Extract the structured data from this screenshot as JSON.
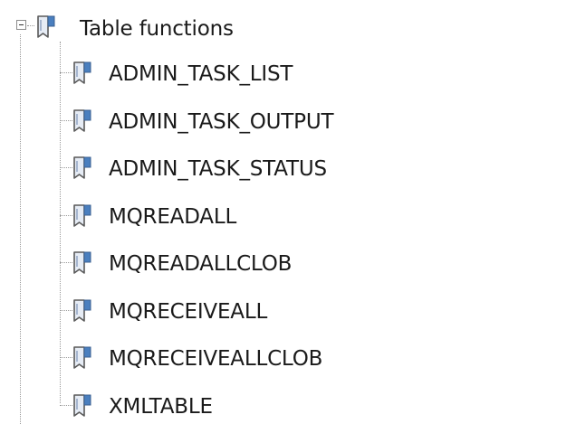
{
  "tree": {
    "root": {
      "label": "Table functions",
      "icon": "function-folder-icon",
      "expanded": true
    },
    "items": [
      {
        "label": "ADMIN_TASK_LIST",
        "icon": "function-icon"
      },
      {
        "label": "ADMIN_TASK_OUTPUT",
        "icon": "function-icon"
      },
      {
        "label": "ADMIN_TASK_STATUS",
        "icon": "function-icon"
      },
      {
        "label": "MQREADALL",
        "icon": "function-icon"
      },
      {
        "label": "MQREADALLCLOB",
        "icon": "function-icon"
      },
      {
        "label": "MQRECEIVEALL",
        "icon": "function-icon"
      },
      {
        "label": "MQRECEIVEALLCLOB",
        "icon": "function-icon"
      },
      {
        "label": "XMLTABLE",
        "icon": "function-icon"
      }
    ]
  },
  "colors": {
    "connector": "#9a9a9a",
    "icon_outline": "#5a5a5a",
    "icon_body": "#e6ecf5",
    "icon_tab": "#4a7fbf"
  }
}
